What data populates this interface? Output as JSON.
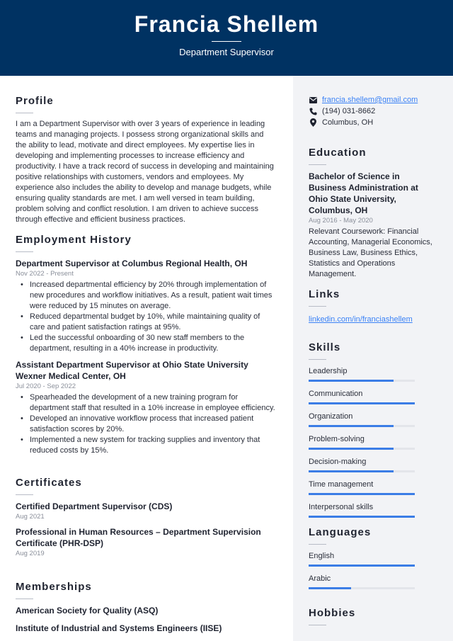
{
  "header": {
    "name": "Francia Shellem",
    "title": "Department Supervisor",
    "background": "#003262"
  },
  "profile": {
    "heading": "Profile",
    "text": "I am a Department Supervisor with over 3 years of experience in leading teams and managing projects. I possess strong organizational skills and the ability to lead, motivate and direct employees. My expertise lies in developing and implementing processes to increase efficiency and productivity. I have a track record of success in developing and maintaining positive relationships with customers, vendors and employees. My experience also includes the ability to develop and manage budgets, while ensuring quality standards are met. I am well versed in team building, problem solving and conflict resolution. I am driven to achieve success through effective and efficient business practices."
  },
  "employment": {
    "heading": "Employment History",
    "jobs": [
      {
        "title": "Department Supervisor at Columbus Regional Health, OH",
        "date": "Nov 2022 - Present",
        "bullets": [
          "Increased departmental efficiency by 20% through implementation of new procedures and workflow initiatives. As a result, patient wait times were reduced by 15 minutes on average.",
          "Reduced departmental budget by 10%, while maintaining quality of care and patient satisfaction ratings at 95%.",
          "Led the successful onboarding of 30 new staff members to the department, resulting in a 40% increase in productivity."
        ]
      },
      {
        "title": "Assistant Department Supervisor at Ohio State University Wexner Medical Center, OH",
        "date": "Jul 2020 - Sep 2022",
        "bullets": [
          "Spearheaded the development of a new training program for department staff that resulted in a 10% increase in employee efficiency.",
          "Developed an innovative workflow process that increased patient satisfaction scores by 20%.",
          "Implemented a new system for tracking supplies and inventory that reduced costs by 15%."
        ]
      }
    ]
  },
  "certificates": {
    "heading": "Certificates",
    "items": [
      {
        "title": "Certified Department Supervisor (CDS)",
        "date": "Aug 2021"
      },
      {
        "title": "Professional in Human Resources – Department Supervision Certificate (PHR-DSP)",
        "date": "Aug 2019"
      }
    ]
  },
  "memberships": {
    "heading": "Memberships",
    "items": [
      "American Society for Quality (ASQ)",
      "Institute of Industrial and Systems Engineers (IISE)"
    ]
  },
  "contact": {
    "email": "francia.shellem@gmail.com",
    "phone": "(194) 031-8662",
    "location": "Columbus, OH",
    "icons": [
      "envelope-icon",
      "phone-icon",
      "map-pin-icon"
    ]
  },
  "education": {
    "heading": "Education",
    "degree": "Bachelor of Science in Business Administration at Ohio State University, Columbus, OH",
    "date": "Aug 2016 - May 2020",
    "details": "Relevant Coursework: Financial Accounting, Managerial Economics, Business Law, Business Ethics, Statistics and Operations Management."
  },
  "links": {
    "heading": "Links",
    "items": [
      "linkedin.com/in/franciashellem"
    ]
  },
  "skills": {
    "heading": "Skills",
    "items": [
      {
        "name": "Leadership",
        "level": 0.8
      },
      {
        "name": "Communication",
        "level": 1.0
      },
      {
        "name": "Organization",
        "level": 0.8
      },
      {
        "name": "Problem-solving",
        "level": 0.8
      },
      {
        "name": "Decision-making",
        "level": 0.8
      },
      {
        "name": "Time management",
        "level": 1.0
      },
      {
        "name": "Interpersonal skills",
        "level": 1.0
      }
    ]
  },
  "languages": {
    "heading": "Languages",
    "items": [
      {
        "name": "English",
        "level": 1.0
      },
      {
        "name": "Arabic",
        "level": 0.4
      }
    ]
  },
  "hobbies": {
    "heading": "Hobbies"
  },
  "colors": {
    "accent": "#3b7de6",
    "link": "#3b82f6",
    "sidebar_bg": "#f2f3f6"
  }
}
